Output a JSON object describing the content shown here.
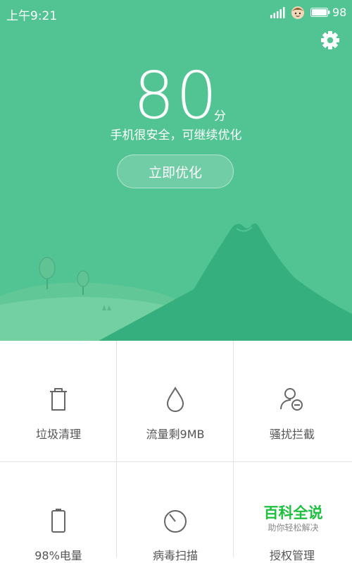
{
  "status_bar": {
    "time": "上午9:21",
    "battery": "98"
  },
  "score": {
    "value": "80",
    "unit": "分",
    "message": "手机很安全，可继续优化"
  },
  "primary_action": {
    "label": "立即优化"
  },
  "tools": [
    {
      "label": "垃圾清理",
      "icon": "trash-icon"
    },
    {
      "label": "流量剩9MB",
      "icon": "drop-icon"
    },
    {
      "label": "骚扰拦截",
      "icon": "block-user-icon"
    },
    {
      "label": "98%电量",
      "icon": "battery-icon"
    },
    {
      "label": "病毒扫描",
      "icon": "scan-icon"
    },
    {
      "label": "授权管理",
      "icon": "permission-icon"
    }
  ],
  "watermark": {
    "title": "百科全说",
    "subtitle": "助你轻松解决"
  },
  "colors": {
    "hero": "#52c393",
    "mountain": "#34af7d",
    "hill": "#73cd9f",
    "icon": "#666666"
  }
}
